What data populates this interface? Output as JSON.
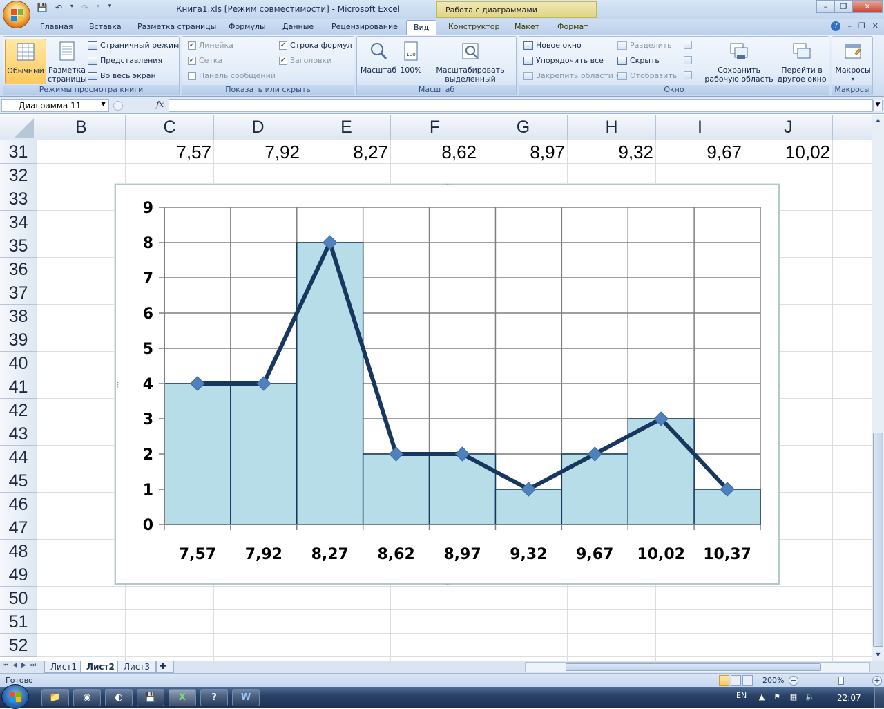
{
  "window": {
    "title": "Книга1.xls  [Режим совместимости] - Microsoft Excel",
    "context_tab_title": "Работа с диаграммами",
    "minimize": "–",
    "restore": "❐",
    "close": "✕"
  },
  "ribbon_tabs": [
    "Главная",
    "Вставка",
    "Разметка страницы",
    "Формулы",
    "Данные",
    "Рецензирование",
    "Вид",
    "Конструктор",
    "Макет",
    "Формат"
  ],
  "active_tab": "Вид",
  "ribbon": {
    "views": {
      "label": "Режимы просмотра книги",
      "normal": "Обычный",
      "page_layout_1": "Разметка",
      "page_layout_2": "страницы",
      "page_break": "Страничный режим",
      "custom_views": "Представления",
      "full_screen": "Во весь экран"
    },
    "show_hide": {
      "label": "Показать или скрыть",
      "ruler": "Линейка",
      "gridlines": "Сетка",
      "message_bar": "Панель сообщений",
      "formula_bar": "Строка формул",
      "headings": "Заголовки",
      "check": "✓"
    },
    "zoom": {
      "label": "Масштаб",
      "zoom": "Масштаб",
      "zoom100": "100%",
      "zoom_sel_1": "Масштабировать",
      "zoom_sel_2": "выделенный фрагмент"
    },
    "window": {
      "label": "Окно",
      "new_window": "Новое окно",
      "arrange_all": "Упорядочить все",
      "freeze": "Закрепить области",
      "split": "Разделить",
      "hide": "Скрыть",
      "unhide": "Отобразить",
      "save_ws_1": "Сохранить",
      "save_ws_2": "рабочую область",
      "switch_1": "Перейти в",
      "switch_2": "другое окно"
    },
    "macros": {
      "label": "Макросы",
      "macros": "Макросы"
    }
  },
  "formula_bar": {
    "name_box": "Диаграмма 11",
    "fx": "fx",
    "formula": ""
  },
  "grid": {
    "columns": [
      "B",
      "C",
      "D",
      "E",
      "F",
      "G",
      "H",
      "I",
      "J"
    ],
    "rows": [
      "31",
      "32",
      "33",
      "34",
      "35",
      "36",
      "37",
      "38",
      "39",
      "40",
      "41",
      "42",
      "43",
      "44",
      "45",
      "46",
      "47",
      "48",
      "49",
      "50",
      "51",
      "52"
    ],
    "row31_values": [
      "7,57",
      "7,92",
      "8,27",
      "8,62",
      "8,97",
      "9,32",
      "9,67",
      "10,02"
    ]
  },
  "chart_data": {
    "type": "bar",
    "categories": [
      "7,57",
      "7,92",
      "8,27",
      "8,62",
      "8,97",
      "9,32",
      "9,67",
      "10,02",
      "10,37"
    ],
    "series": [
      {
        "type": "bar",
        "values": [
          4,
          4,
          8,
          2,
          2,
          1,
          2,
          3,
          1
        ]
      },
      {
        "type": "line",
        "values": [
          4,
          4,
          8,
          2,
          2,
          1,
          2,
          3,
          1
        ]
      }
    ],
    "yticks": [
      "0",
      "1",
      "2",
      "3",
      "4",
      "5",
      "6",
      "7",
      "8",
      "9"
    ],
    "ylim": [
      0,
      9
    ],
    "grid": true,
    "bar_gap": 0,
    "colors": {
      "bar_fill": "#b7dde8",
      "bar_stroke": "#17375e",
      "line": "#17375e",
      "marker": "#4f81bd"
    }
  },
  "sheets": [
    "Лист1",
    "Лист2",
    "Лист3"
  ],
  "active_sheet": "Лист2",
  "status": {
    "ready": "Готово",
    "zoom": "200%",
    "zoom_minus": "−",
    "zoom_plus": "+",
    "zoom_level": 0.58
  },
  "taskbar": {
    "lang": "EN",
    "time": "22:07"
  }
}
